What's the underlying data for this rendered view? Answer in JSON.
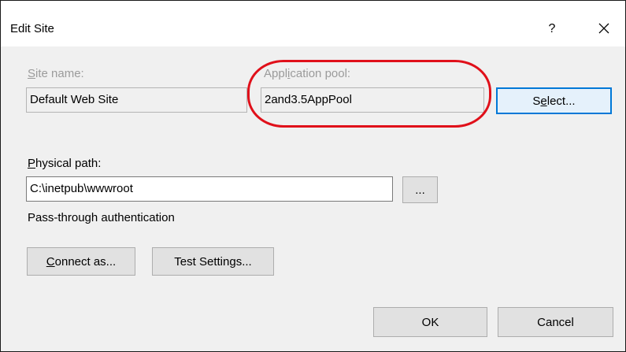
{
  "window": {
    "title": "Edit Site",
    "help_glyph": "?"
  },
  "site_name": {
    "label_accel": "S",
    "label_rest": "ite name:",
    "value": "Default Web Site"
  },
  "app_pool": {
    "label_pre": "Appl",
    "label_accel": "i",
    "label_post": "cation pool:",
    "value": "2and3.5AppPool",
    "highlight_color": "#e0101a"
  },
  "select_button": {
    "label_pre": "S",
    "label_accel": "e",
    "label_post": "lect..."
  },
  "physical_path": {
    "label_accel": "P",
    "label_rest": "hysical path:",
    "value": "C:\\inetpub\\wwwroot",
    "browse_label": "..."
  },
  "pass_through": {
    "text": "Pass-through authentication"
  },
  "connect_button": {
    "label_accel": "C",
    "label_rest": "onnect as..."
  },
  "test_button": {
    "label_pre": "Test Settin",
    "label_accel": "g",
    "label_post": "s..."
  },
  "footer": {
    "ok_label": "OK",
    "cancel_label": "Cancel"
  },
  "colors": {
    "focus_border": "#0078d7",
    "dialog_bg": "#f0f0f0",
    "disabled_text": "#9b9b9b"
  },
  "icons": {
    "close": "close-icon"
  }
}
